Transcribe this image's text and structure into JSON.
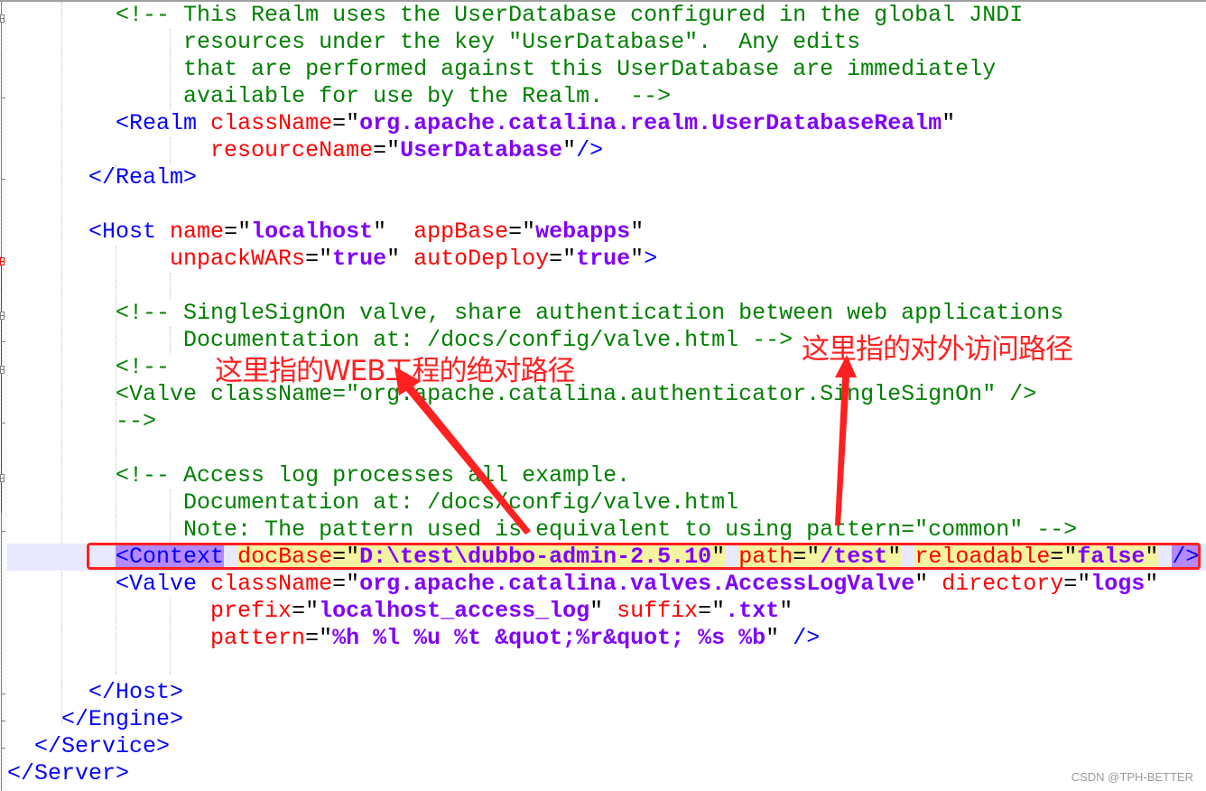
{
  "editor": {
    "lines": [
      {
        "indent": "        ",
        "segments": [
          {
            "cls": "c",
            "text": "<!-- This Realm uses the UserDatabase configured in the global JNDI"
          }
        ]
      },
      {
        "indent": "             ",
        "segments": [
          {
            "cls": "c",
            "text": "resources under the key \"UserDatabase\".  Any edits"
          }
        ]
      },
      {
        "indent": "             ",
        "segments": [
          {
            "cls": "c",
            "text": "that are performed against this UserDatabase are immediately"
          }
        ]
      },
      {
        "indent": "             ",
        "segments": [
          {
            "cls": "c",
            "text": "available for use by the Realm.  -->"
          }
        ]
      },
      {
        "indent": "        ",
        "segments": [
          {
            "cls": "t",
            "text": "<Realm"
          },
          {
            "cls": "e",
            "text": " "
          },
          {
            "cls": "a",
            "text": "className"
          },
          {
            "cls": "q",
            "text": "=\""
          },
          {
            "cls": "v",
            "text": "org.apache.catalina.realm.UserDatabaseRealm"
          },
          {
            "cls": "q",
            "text": "\""
          }
        ]
      },
      {
        "indent": "               ",
        "segments": [
          {
            "cls": "a",
            "text": "resourceName"
          },
          {
            "cls": "q",
            "text": "=\""
          },
          {
            "cls": "v",
            "text": "UserDatabase"
          },
          {
            "cls": "q",
            "text": "\""
          },
          {
            "cls": "t",
            "text": "/>"
          }
        ]
      },
      {
        "indent": "      ",
        "segments": [
          {
            "cls": "t",
            "text": "</Realm>"
          }
        ]
      },
      {
        "indent": "",
        "segments": []
      },
      {
        "indent": "      ",
        "segments": [
          {
            "cls": "t",
            "text": "<Host"
          },
          {
            "cls": "e",
            "text": " "
          },
          {
            "cls": "a",
            "text": "name"
          },
          {
            "cls": "q",
            "text": "=\""
          },
          {
            "cls": "v",
            "text": "localhost"
          },
          {
            "cls": "q",
            "text": "\"  "
          },
          {
            "cls": "a",
            "text": "appBase"
          },
          {
            "cls": "q",
            "text": "=\""
          },
          {
            "cls": "v",
            "text": "webapps"
          },
          {
            "cls": "q",
            "text": "\""
          }
        ]
      },
      {
        "indent": "            ",
        "segments": [
          {
            "cls": "a",
            "text": "unpackWARs"
          },
          {
            "cls": "q",
            "text": "=\""
          },
          {
            "cls": "v",
            "text": "true"
          },
          {
            "cls": "q",
            "text": "\" "
          },
          {
            "cls": "a",
            "text": "autoDeploy"
          },
          {
            "cls": "q",
            "text": "=\""
          },
          {
            "cls": "v",
            "text": "true"
          },
          {
            "cls": "q",
            "text": "\""
          },
          {
            "cls": "t",
            "text": ">"
          }
        ]
      },
      {
        "indent": "",
        "segments": []
      },
      {
        "indent": "        ",
        "segments": [
          {
            "cls": "c",
            "text": "<!-- SingleSignOn valve, share authentication between web applications"
          }
        ]
      },
      {
        "indent": "             ",
        "segments": [
          {
            "cls": "c",
            "text": "Documentation at: /docs/config/valve.html -->"
          }
        ]
      },
      {
        "indent": "        ",
        "segments": [
          {
            "cls": "c",
            "text": "<!--"
          }
        ]
      },
      {
        "indent": "        ",
        "segments": [
          {
            "cls": "c",
            "text": "<Valve className=\"org.apache.catalina.authenticator.SingleSignOn\" />"
          }
        ]
      },
      {
        "indent": "        ",
        "segments": [
          {
            "cls": "c",
            "text": "-->"
          }
        ]
      },
      {
        "indent": "",
        "segments": []
      },
      {
        "indent": "        ",
        "segments": [
          {
            "cls": "c",
            "text": "<!-- Access log processes all example."
          }
        ]
      },
      {
        "indent": "             ",
        "segments": [
          {
            "cls": "c",
            "text": "Documentation at: /docs/config/valve.html"
          }
        ]
      },
      {
        "indent": "             ",
        "segments": [
          {
            "cls": "c",
            "text": "Note: The pattern used is equivalent to using pattern=\"common\" -->"
          }
        ]
      },
      {
        "indent": "        ",
        "current": true,
        "segments": [
          {
            "cls": "t hl-tag",
            "text": "<Context"
          },
          {
            "cls": "e",
            "text": " "
          },
          {
            "cls": "a hl-attr",
            "text": "docBase"
          },
          {
            "cls": "q hl-attr",
            "text": "=\""
          },
          {
            "cls": "v hl-attr",
            "text": "D:\\test\\dubbo-admin-2.5.10"
          },
          {
            "cls": "q hl-attr",
            "text": "\""
          },
          {
            "cls": "e",
            "text": " "
          },
          {
            "cls": "a hl-attr",
            "text": "path"
          },
          {
            "cls": "q hl-attr",
            "text": "=\""
          },
          {
            "cls": "v hl-attr",
            "text": "/test"
          },
          {
            "cls": "q hl-attr",
            "text": "\""
          },
          {
            "cls": "e",
            "text": " "
          },
          {
            "cls": "a hl-attr",
            "text": "reloadable"
          },
          {
            "cls": "q hl-attr",
            "text": "=\""
          },
          {
            "cls": "v hl-attr",
            "text": "false"
          },
          {
            "cls": "q hl-attr",
            "text": "\""
          },
          {
            "cls": "e",
            "text": " "
          },
          {
            "cls": "t hl-tag",
            "text": "/>"
          }
        ]
      },
      {
        "indent": "        ",
        "segments": [
          {
            "cls": "t",
            "text": "<Valve"
          },
          {
            "cls": "e",
            "text": " "
          },
          {
            "cls": "a",
            "text": "className"
          },
          {
            "cls": "q",
            "text": "=\""
          },
          {
            "cls": "v",
            "text": "org.apache.catalina.valves.AccessLogValve"
          },
          {
            "cls": "q",
            "text": "\" "
          },
          {
            "cls": "a",
            "text": "directory"
          },
          {
            "cls": "q",
            "text": "=\""
          },
          {
            "cls": "v",
            "text": "logs"
          },
          {
            "cls": "q",
            "text": "\""
          }
        ]
      },
      {
        "indent": "               ",
        "segments": [
          {
            "cls": "a",
            "text": "prefix"
          },
          {
            "cls": "q",
            "text": "=\""
          },
          {
            "cls": "v",
            "text": "localhost_access_log"
          },
          {
            "cls": "q",
            "text": "\" "
          },
          {
            "cls": "a",
            "text": "suffix"
          },
          {
            "cls": "q",
            "text": "=\""
          },
          {
            "cls": "v",
            "text": ".txt"
          },
          {
            "cls": "q",
            "text": "\""
          }
        ]
      },
      {
        "indent": "               ",
        "segments": [
          {
            "cls": "a",
            "text": "pattern"
          },
          {
            "cls": "q",
            "text": "=\""
          },
          {
            "cls": "v",
            "text": "%h %l %u %t &quot;%r&quot; %s %b"
          },
          {
            "cls": "q",
            "text": "\" "
          },
          {
            "cls": "t",
            "text": "/>"
          }
        ]
      },
      {
        "indent": "",
        "segments": []
      },
      {
        "indent": "      ",
        "segments": [
          {
            "cls": "t",
            "text": "</Host>"
          }
        ]
      },
      {
        "indent": "    ",
        "segments": [
          {
            "cls": "t",
            "text": "</Engine>"
          }
        ]
      },
      {
        "indent": "  ",
        "segments": [
          {
            "cls": "t",
            "text": "</Service>"
          }
        ]
      },
      {
        "indent": "",
        "segments": [
          {
            "cls": "t",
            "text": "</Server>"
          }
        ]
      }
    ]
  },
  "annotations": {
    "docbase_note": "这里指的WEB工程的绝对路径",
    "path_note": "这里指的对外访问路径"
  },
  "watermark": "CSDN @TPH-BETTER"
}
